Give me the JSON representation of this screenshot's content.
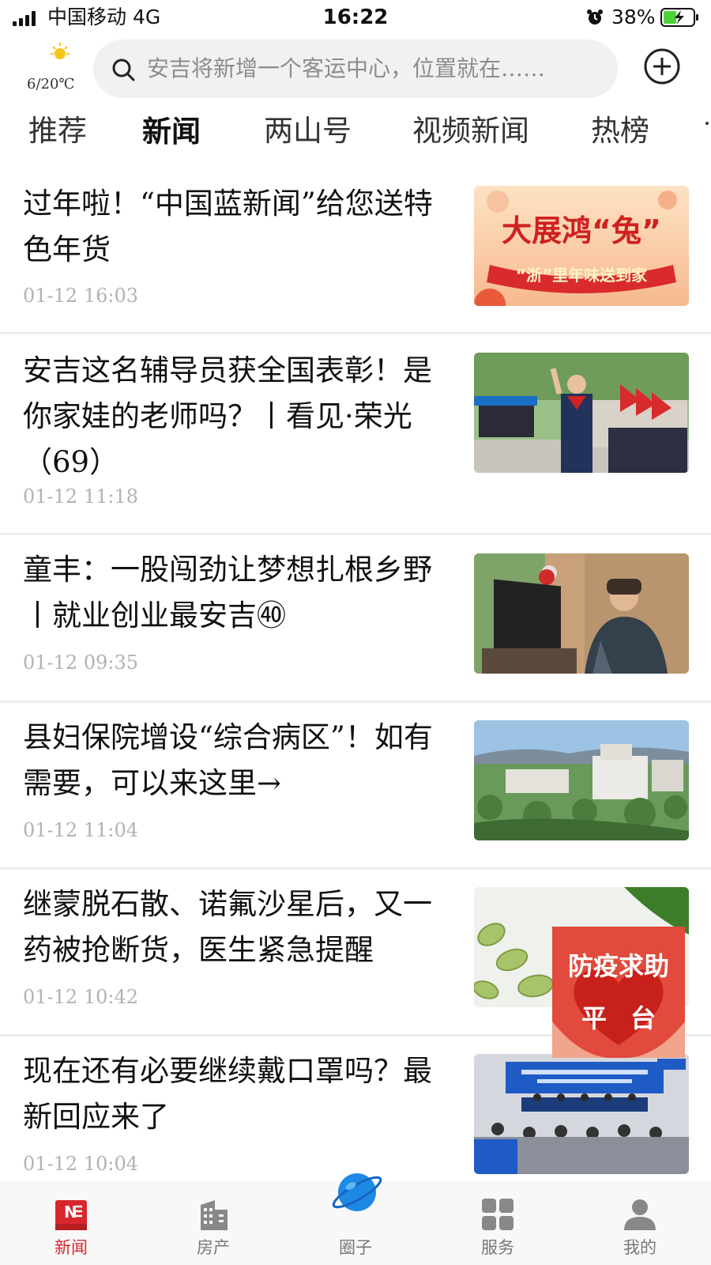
{
  "status_bar": {
    "carrier": "中国移动  4G",
    "time": "16:22",
    "battery": "38%"
  },
  "header": {
    "weather": "6/20℃",
    "search_placeholder": "安吉将新增一个客运中心，位置就在……"
  },
  "tabs": [
    "推荐",
    "新闻",
    "两山号",
    "视频新闻",
    "热榜"
  ],
  "active_tab": "新闻",
  "articles": [
    {
      "title": "过年啦！“中国蓝新闻”给您送特色年货",
      "time": "01-12 16:03",
      "thumb_text_1": "大展鸿“兔”",
      "thumb_text_2": "“浙”里年味送到家"
    },
    {
      "title": "安吉这名辅导员获全国表彰！是你家娃的老师吗？丨看见·荣光（69）",
      "time": "01-12 11:18"
    },
    {
      "title": "童丰：一股闯劲让梦想扎根乡野丨就业创业最安吉㊵",
      "time": "01-12 09:35"
    },
    {
      "title": "县妇保院增设“综合病区”！如有需要，可以来这里→",
      "time": "01-12 11:04"
    },
    {
      "title": "继蒙脱石散、诺氟沙星后，又一药被抢断货，医生紧急提醒",
      "time": "01-12 10:42"
    },
    {
      "title": "现在还有必要继续戴口罩吗？最新回应来了",
      "time": "01-12 10:04"
    }
  ],
  "float_widget": {
    "line1": "防疫求助",
    "line2": "平台"
  },
  "bottom_nav": {
    "items": [
      {
        "label": "新闻",
        "icon": "news-icon",
        "active": true
      },
      {
        "label": "房产",
        "icon": "building-icon",
        "active": false
      },
      {
        "label": "圈子",
        "icon": "planet-icon",
        "active": false
      },
      {
        "label": "服务",
        "icon": "grid-icon",
        "active": false
      },
      {
        "label": "我的",
        "icon": "person-icon",
        "active": false
      }
    ]
  },
  "colors": {
    "accent": "#d7262c",
    "planet": "#1e88e5",
    "widget": "#e14a3c"
  }
}
